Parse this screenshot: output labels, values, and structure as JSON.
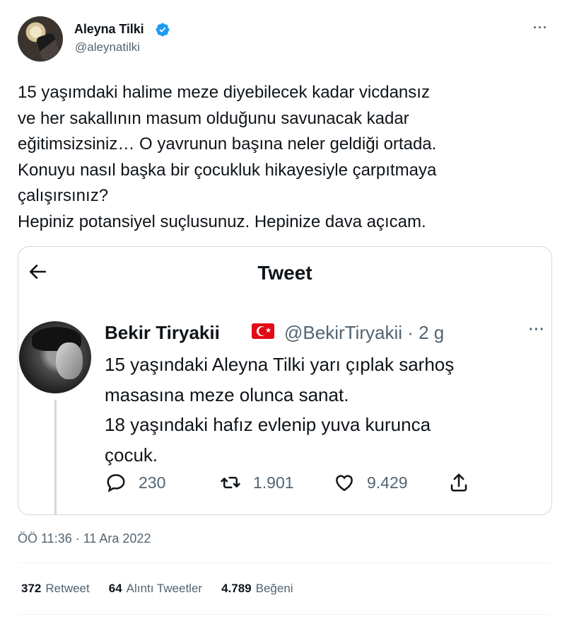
{
  "author": {
    "display_name": "Aleyna Tilki",
    "handle": "@aleynatilki",
    "verified": true,
    "verified_color": "#1d9bf0"
  },
  "tweet": {
    "text": "15 yaşımdaki halime meze diyebilecek kadar vicdansız\nve her sakallının masum olduğunu savunacak kadar\neğitimsizsiniz… O yavrunun başına neler geldiği ortada.\nKonuyu nasıl başka bir çocukluk hikayesiyle çarpıtmaya\nçalışırsınız?\nHepiniz potansiyel suçlusunuz. Hepinize dava açıcam.",
    "timestamp": "ÖÖ 11:36 · 11 Ara 2022"
  },
  "quoted_screenshot": {
    "header_title": "Tweet",
    "back_icon": "arrow-left-icon",
    "author_name": "Bekir Tiryakii",
    "flag_icon": "turkey-flag-icon",
    "author_handle_time": "@BekirTiryakii · 2 g",
    "text": "15 yaşındaki Aleyna Tilki yarı çıplak sarhoş\nmasasına meze olunca sanat.\n18 yaşındaki hafız evlenip yuva kurunca\nçocuk.",
    "actions": {
      "replies": "230",
      "retweets": "1.901",
      "likes": "9.429"
    }
  },
  "stats": {
    "retweets_count": "372",
    "retweets_label": "Retweet",
    "quotes_count": "64",
    "quotes_label": "Alıntı Tweetler",
    "likes_count": "4.789",
    "likes_label": "Beğeni"
  },
  "icons": [
    "more-icon",
    "verified-badge-icon",
    "reply-icon",
    "retweet-icon",
    "like-icon",
    "share-icon"
  ]
}
